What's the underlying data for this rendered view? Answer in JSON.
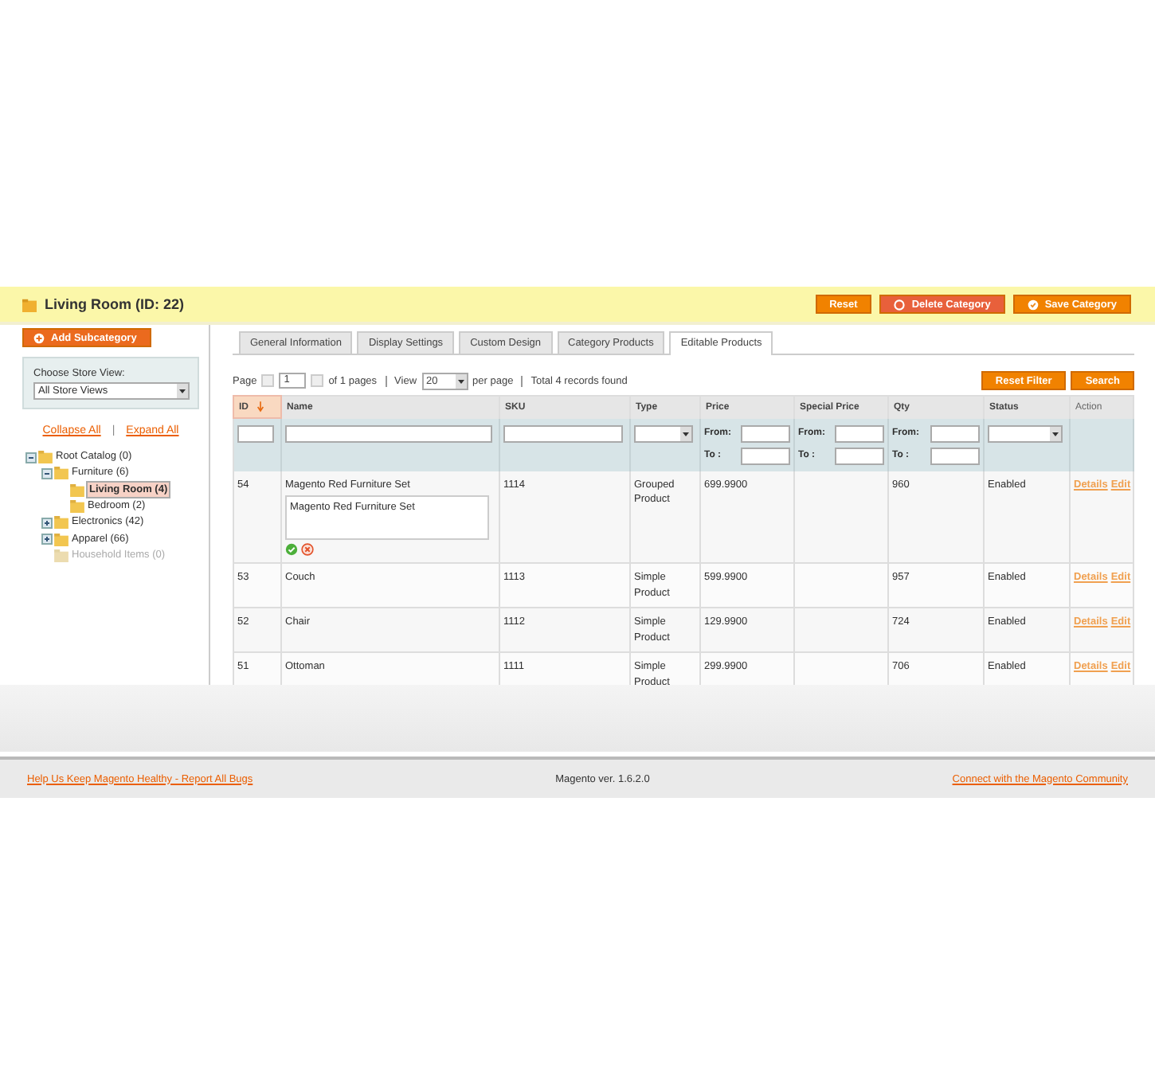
{
  "header": {
    "title": "Living Room (ID: 22)",
    "buttons": [
      {
        "label": "Reset",
        "kind": "plain"
      },
      {
        "label": "Delete Category",
        "kind": "delete"
      },
      {
        "label": "Save Category",
        "kind": "save"
      }
    ]
  },
  "sidebar": {
    "add_button": "Add Subcategory",
    "store_view": {
      "label": "Choose Store View:",
      "value": "All Store Views"
    },
    "collapse": "Collapse All",
    "separator": "|",
    "expand": "Expand All",
    "tree": [
      {
        "label": "Root Catalog (0)",
        "expanded": true,
        "selected": false,
        "disabled": false,
        "children": [
          {
            "label": "Furniture (6)",
            "expanded": true,
            "selected": false,
            "disabled": false,
            "children": [
              {
                "label": "Living Room (4)",
                "selected": true,
                "disabled": false
              },
              {
                "label": "Bedroom (2)",
                "selected": false,
                "disabled": false
              }
            ]
          },
          {
            "label": "Electronics (42)",
            "expanded": false,
            "selected": false,
            "disabled": false
          },
          {
            "label": "Apparel (66)",
            "expanded": false,
            "selected": false,
            "disabled": false
          },
          {
            "label": "Household Items (0)",
            "selected": false,
            "disabled": true
          }
        ]
      }
    ]
  },
  "tabs": [
    {
      "label": "General Information",
      "selected": false
    },
    {
      "label": "Display Settings",
      "selected": false
    },
    {
      "label": "Custom Design",
      "selected": false
    },
    {
      "label": "Category Products",
      "selected": false
    },
    {
      "label": "Editable Products",
      "selected": true
    }
  ],
  "pager": {
    "page_label": "Page",
    "page": "1",
    "of_pages": "of 1 pages",
    "view_label": "View",
    "per_page": "20",
    "per_page_label": "per page",
    "total": "Total 4 records found"
  },
  "grid_buttons": [
    "Reset Filter",
    "Search"
  ],
  "columns": [
    {
      "label": "ID",
      "sorted": true,
      "kind": "text"
    },
    {
      "label": "Name",
      "sorted": false,
      "kind": "text"
    },
    {
      "label": "SKU",
      "sorted": false,
      "kind": "text"
    },
    {
      "label": "Type",
      "sorted": false,
      "kind": "select"
    },
    {
      "label": "Price",
      "sorted": false,
      "kind": "range",
      "from_label": "From:",
      "to_label": "To :"
    },
    {
      "label": "Special Price",
      "sorted": false,
      "kind": "range",
      "from_label": "From:",
      "to_label": "To :"
    },
    {
      "label": "Qty",
      "sorted": false,
      "kind": "range",
      "from_label": "From:",
      "to_label": "To :"
    },
    {
      "label": "Status",
      "sorted": false,
      "kind": "select"
    },
    {
      "label": "Action",
      "sorted": false,
      "kind": "none"
    }
  ],
  "rows": [
    {
      "id": "54",
      "name": "Magento Red Furniture Set",
      "editing": true,
      "edit_value": "Magento Red Furniture Set",
      "sku": "1114",
      "type": "Grouped Product",
      "price": "699.9900",
      "qty": "960",
      "status": "Enabled",
      "actions": [
        "Details",
        "Edit"
      ]
    },
    {
      "id": "53",
      "name": "Couch",
      "editing": false,
      "sku": "1113",
      "type": "Simple Product",
      "price": "599.9900",
      "qty": "957",
      "status": "Enabled",
      "actions": [
        "Details",
        "Edit"
      ]
    },
    {
      "id": "52",
      "name": "Chair",
      "editing": false,
      "sku": "1112",
      "type": "Simple Product",
      "price": "129.9900",
      "qty": "724",
      "status": "Enabled",
      "actions": [
        "Details",
        "Edit"
      ]
    },
    {
      "id": "51",
      "name": "Ottoman",
      "editing": false,
      "sku": "1111",
      "type": "Simple Product",
      "price": "299.9900",
      "qty": "706",
      "status": "Enabled",
      "actions": [
        "Details",
        "Edit"
      ]
    }
  ],
  "footer": {
    "left_link": "Help Us Keep Magento Healthy - Report All Bugs",
    "version": "Magento ver. 1.6.2.0",
    "right_link": "Connect with the Magento Community"
  }
}
